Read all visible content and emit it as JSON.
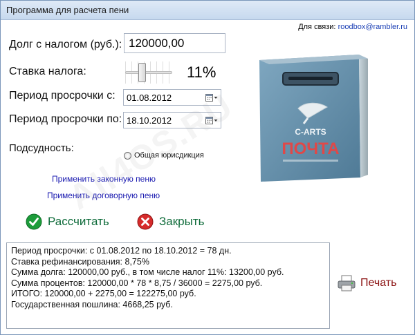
{
  "window": {
    "title": "Программа для расчета пени"
  },
  "contact": {
    "label": "Для связи:",
    "email": "roodbox@rambler.ru"
  },
  "form": {
    "debt_label": "Долг с налогом (руб.):",
    "debt_value": "120000,00",
    "rate_label": "Ставка налога:",
    "rate_value": "11%",
    "rate_level_percent": 11,
    "period_from_label": "Период просрочки с:",
    "period_from_value": "01.08.2012",
    "period_to_label": "Период просрочки по:",
    "period_to_value": "18.10.2012",
    "jurisdiction_label": "Подсудность:",
    "jurisdiction_option": "Общая юрисдикция"
  },
  "links": {
    "legal": "Применить законную пеню",
    "contract": "Применить договорную пеню"
  },
  "actions": {
    "calculate": "Рассчитать",
    "close": "Закрыть",
    "print": "Печать"
  },
  "product": {
    "brand": "C-ARTS",
    "name": "ПОЧТА"
  },
  "watermark": "All4OS.RU",
  "result_lines": [
    "Период просрочки: с 01.08.2012 по 18.10.2012 = 78 дн.",
    "Ставка рефинансирования: 8,75%",
    "Сумма долга: 120000,00 руб., в том числе налог 11%: 13200,00 руб.",
    "Сумма процентов: 120000,00 * 78 * 8,75 / 36000 = 2275,00 руб.",
    "ИТОГО: 120000,00 + 2275,00 = 122275,00 руб.",
    "Государственная пошлина: 4668,25 руб."
  ],
  "colors": {
    "accent": "#1a3eb4",
    "action_green": "#0e6b3a",
    "print_red": "#8a1010"
  },
  "icons": {
    "calculate": "check-circle-icon",
    "close": "x-circle-icon",
    "print": "printer-icon",
    "calendar": "calendar-icon"
  }
}
